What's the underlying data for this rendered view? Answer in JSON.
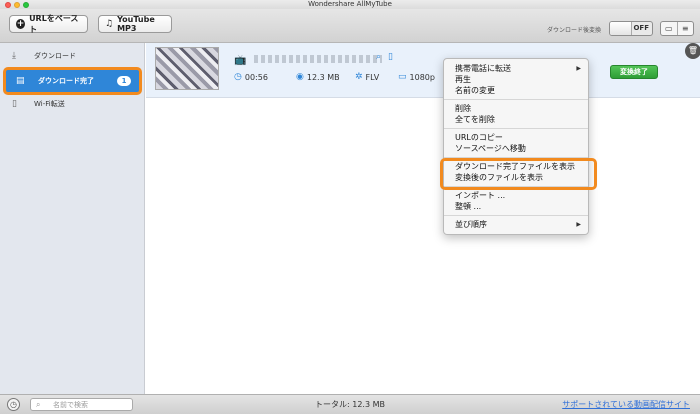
{
  "window": {
    "title": "Wondershare AllMyTube"
  },
  "toolbar": {
    "paste_url_label": "URLをペースト",
    "youtube_mp3_label": "YouTube MP3",
    "convert_after_download_label": "ダウンロード後変換",
    "toggle_state": "OFF"
  },
  "sidebar": {
    "items": [
      {
        "label": "ダウンロード"
      },
      {
        "label": "ダウンロード完了",
        "badge": "1"
      },
      {
        "label": "Wi-Fi転送"
      }
    ]
  },
  "video": {
    "duration": "00:56",
    "size": "12.3 MB",
    "format": "FLV",
    "resolution": "1080p",
    "action_label": "変換終了"
  },
  "context_menu": {
    "items": [
      {
        "label": "携帯電話に転送",
        "submenu": true
      },
      {
        "label": "再生"
      },
      {
        "label": "名前の変更"
      },
      {
        "separator": true
      },
      {
        "label": "削除"
      },
      {
        "label": "全てを削除"
      },
      {
        "separator": true
      },
      {
        "label": "URLのコピー"
      },
      {
        "label": "ソースページへ移動"
      },
      {
        "separator": true
      },
      {
        "label": "ダウンロード完了ファイルを表示"
      },
      {
        "label": "変換後のファイルを表示"
      },
      {
        "separator": true
      },
      {
        "label": "インポート ..."
      },
      {
        "label": "整頓 ..."
      },
      {
        "separator": true
      },
      {
        "label": "並び順序",
        "submenu": true
      }
    ]
  },
  "statusbar": {
    "search_placeholder": "名前で検索",
    "total": "トータル: 12.3 MB",
    "supported_sites_link": "サポートされている動画配信サイト"
  },
  "colors": {
    "accent": "#2f86d8",
    "highlight": "#f28a1e",
    "convert_green": "#3db244"
  }
}
